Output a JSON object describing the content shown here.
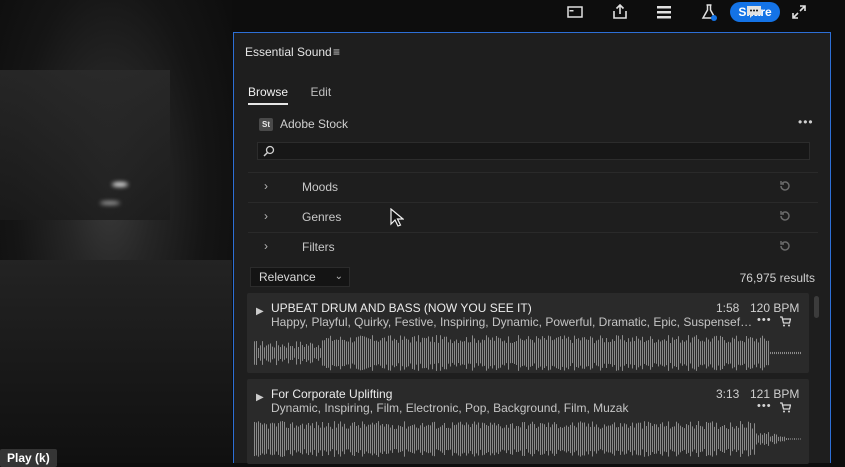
{
  "toolbar": {
    "share_label": "Share",
    "icons": [
      "layout-icon",
      "export-icon",
      "panels-icon",
      "flask-icon",
      "comments-icon",
      "fullscreen-icon"
    ],
    "accent": "#1473e6"
  },
  "video": {
    "play_tooltip": "Play (k)"
  },
  "panel": {
    "title": "Essential Sound",
    "menu_glyph": "≡",
    "tabs": [
      {
        "label": "Browse",
        "active": true
      },
      {
        "label": "Edit",
        "active": false
      }
    ],
    "source": {
      "badge": "St",
      "label": "Adobe Stock",
      "more": "•••"
    },
    "search": {
      "value": "",
      "placeholder": ""
    },
    "filters": [
      {
        "label": "Moods"
      },
      {
        "label": "Genres"
      },
      {
        "label": "Filters"
      }
    ],
    "sort": {
      "value": "Relevance"
    },
    "results": "76,975 results"
  },
  "tracks": [
    {
      "title": "UPBEAT DRUM AND BASS (NOW YOU SEE IT)",
      "tags": "Happy, Playful, Quirky, Festive, Inspiring, Dynamic, Powerful, Dramatic, Epic, Suspenseful, Dance...",
      "duration": "1:58",
      "bpm": "120 BPM",
      "more": "•••"
    },
    {
      "title": "For Corporate Uplifting",
      "tags": "Dynamic, Inspiring, Film, Electronic, Pop, Background, Film, Muzak",
      "duration": "3:13",
      "bpm": "121 BPM",
      "more": "•••"
    }
  ]
}
